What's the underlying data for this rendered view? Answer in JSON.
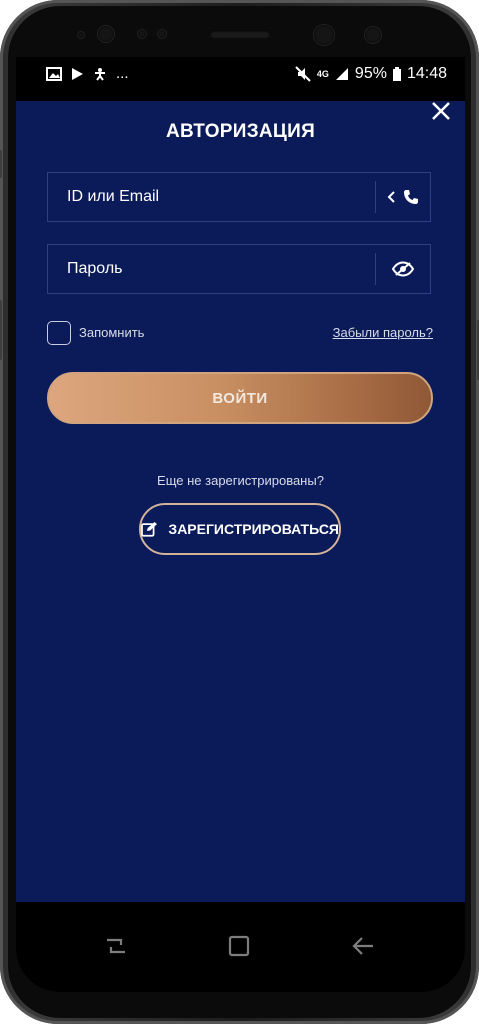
{
  "status_bar": {
    "left_icons": [
      "image-icon",
      "play-store-icon",
      "accessibility-icon"
    ],
    "more": "...",
    "network": "4G",
    "battery": "95%",
    "time": "14:48"
  },
  "auth": {
    "title": "АВТОРИЗАЦИЯ",
    "login_placeholder": "ID или Email",
    "password_placeholder": "Пароль",
    "remember_label": "Запомнить",
    "forgot_link": "Забыли пароль?",
    "login_button": "ВОЙТИ",
    "not_registered": "Еще не зарегистрированы?",
    "register_button": "ЗАРЕГИСТРИРОВАТЬСЯ"
  },
  "colors": {
    "background": "#0b1b5a",
    "field_border": "#2c3f83",
    "login_gradient_start": "#dda67e",
    "login_gradient_end": "#8f5836",
    "register_border": "#d2b39a"
  }
}
